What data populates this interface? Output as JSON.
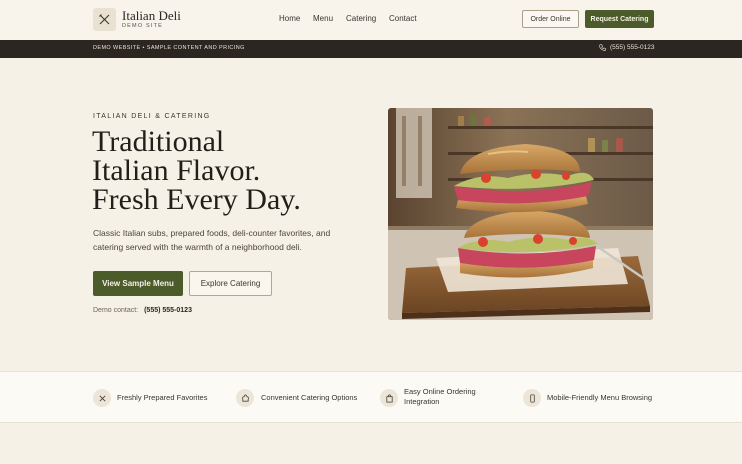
{
  "header": {
    "brand_name": "Italian Deli",
    "brand_sub": "DEMO SITE",
    "nav": [
      "Home",
      "Menu",
      "Catering",
      "Contact"
    ],
    "order_label": "Order Online",
    "catering_label": "Request Catering"
  },
  "topbar": {
    "notice": "DEMO WEBSITE • SAMPLE CONTENT AND PRICING",
    "phone": "(555) 555-0123"
  },
  "hero": {
    "eyebrow": "ITALIAN DELI & CATERING",
    "headline": [
      "Traditional",
      "Italian Flavor.",
      "Fresh Every Day."
    ],
    "description": "Classic Italian subs, prepared foods, deli-counter favorites, and catering served with the warmth of a neighborhood deli.",
    "primary_label": "View Sample Menu",
    "secondary_label": "Explore Catering",
    "contact_label": "Demo contact:",
    "contact_phone": "(555) 555-0123"
  },
  "features": [
    {
      "icon": "utensils-icon",
      "label": "Freshly Prepared Favorites"
    },
    {
      "icon": "chef-hat-icon",
      "label": "Convenient Catering Options"
    },
    {
      "icon": "order-bag-icon",
      "label": "Easy Online Ordering\nIntegration"
    },
    {
      "icon": "mobile-icon",
      "label": "Mobile-Friendly Menu Browsing"
    }
  ],
  "colors": {
    "brand_green": "#4c5b2a",
    "dark_bar": "#2b2622",
    "background": "#f6f1e7"
  }
}
